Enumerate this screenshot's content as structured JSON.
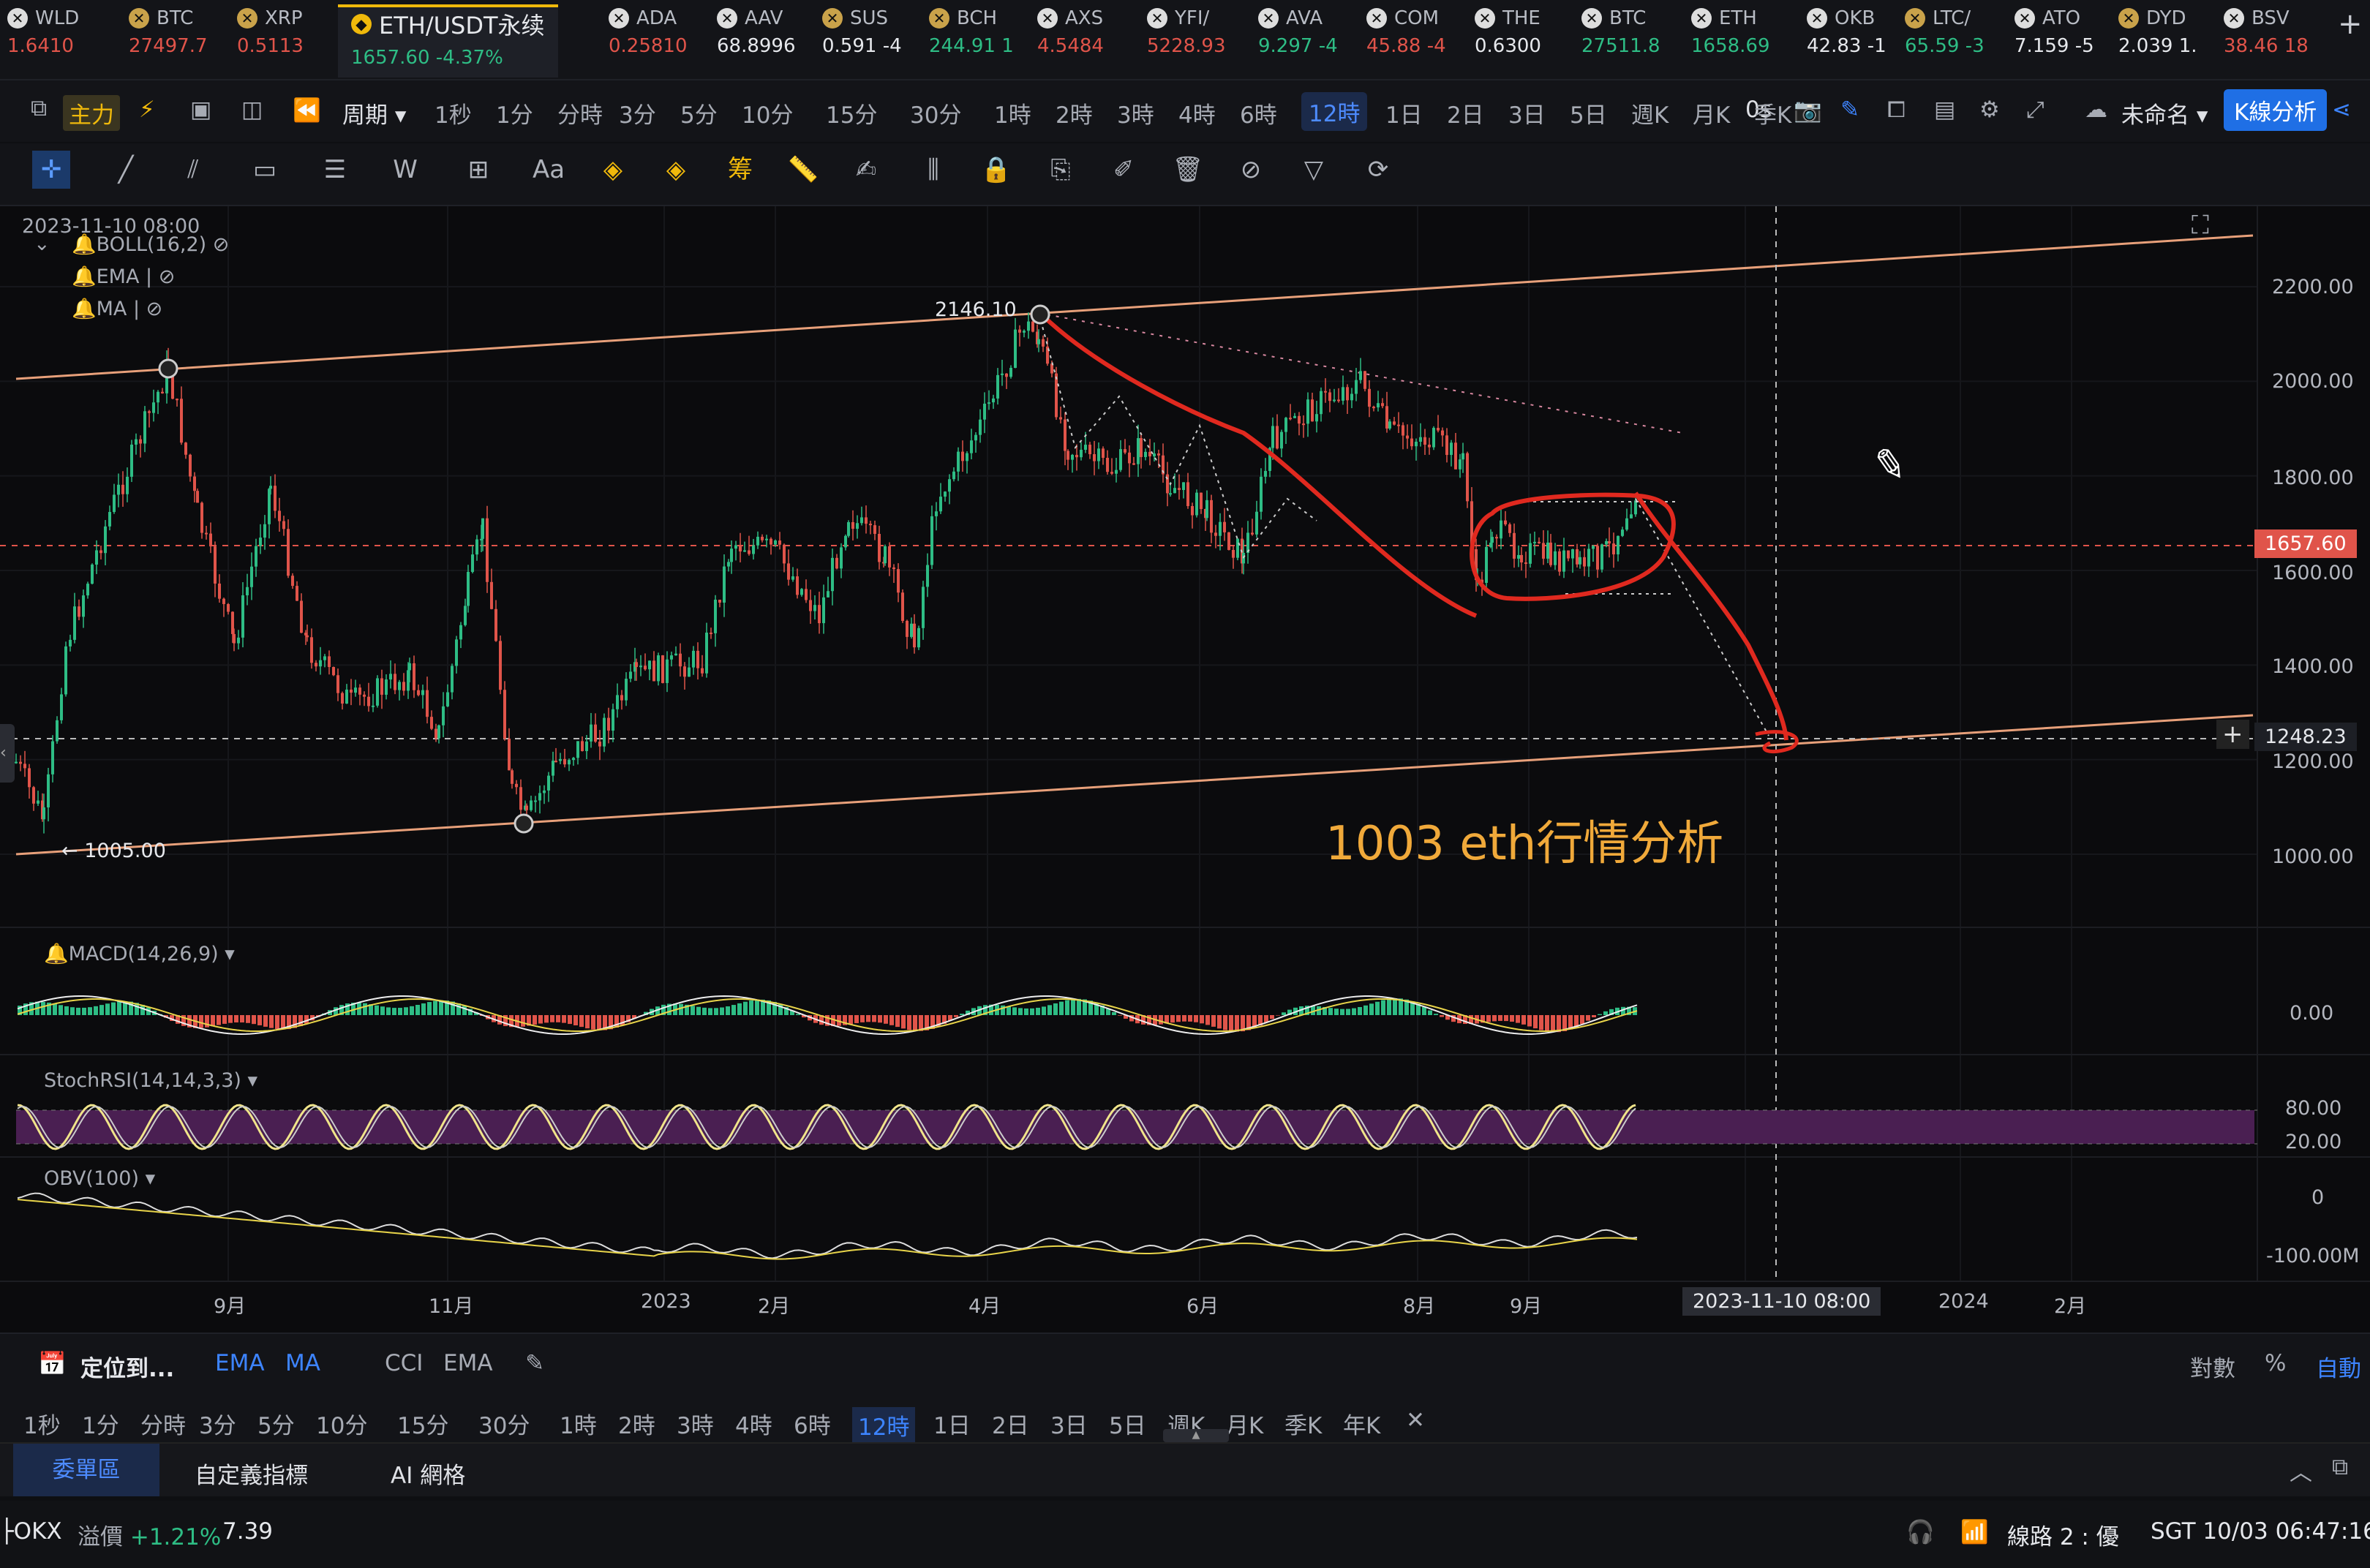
{
  "ticker": [
    {
      "name": "WLD",
      "price": "1.6410",
      "chg": "",
      "color": "red"
    },
    {
      "name": "BTC",
      "price": "27497.7",
      "chg": "",
      "color": "red"
    },
    {
      "name": "XRP",
      "price": "0.5113",
      "chg": "",
      "color": "red"
    },
    {
      "name": "ETH/USDT永续",
      "price": "1657.60",
      "chg": "-4.37%",
      "color": "green"
    },
    {
      "name": "ADA",
      "price": "0.25810",
      "chg": "",
      "color": "red"
    },
    {
      "name": "AAV",
      "price": "68.8996",
      "chg": "",
      "color": "white"
    },
    {
      "name": "SUS",
      "price": "0.591",
      "chg": "-4",
      "color": "white"
    },
    {
      "name": "BCH",
      "price": "244.91",
      "chg": "1",
      "color": "green"
    },
    {
      "name": "AXS",
      "price": "4.5484",
      "chg": "",
      "color": "red"
    },
    {
      "name": "YFI/",
      "price": "5228.93",
      "chg": "",
      "color": "red"
    },
    {
      "name": "AVA",
      "price": "9.297",
      "chg": "-4",
      "color": "green"
    },
    {
      "name": "COM",
      "price": "45.88",
      "chg": "-4",
      "color": "red"
    },
    {
      "name": "THE",
      "price": "0.6300",
      "chg": "",
      "color": "white"
    },
    {
      "name": "BTC",
      "price": "27511.8",
      "chg": "",
      "color": "green"
    },
    {
      "name": "ETH",
      "price": "1658.69",
      "chg": "",
      "color": "green"
    },
    {
      "name": "OKB",
      "price": "42.83",
      "chg": "-1",
      "color": "white"
    },
    {
      "name": "LTC/",
      "price": "65.59",
      "chg": "-3",
      "color": "green"
    },
    {
      "name": "ATO",
      "price": "7.159",
      "chg": "-5",
      "color": "white"
    },
    {
      "name": "DYD",
      "price": "2.039",
      "chg": "1.",
      "color": "white"
    },
    {
      "name": "BSV",
      "price": "38.46",
      "chg": "18",
      "color": "red"
    }
  ],
  "toolbar": {
    "main_label": "主力",
    "period_label": "周期",
    "intervals": [
      "1秒",
      "1分",
      "分時",
      "3分",
      "5分",
      "10分",
      "15分",
      "30分",
      "1時",
      "2時",
      "3時",
      "4時",
      "6時",
      "12時",
      "1日",
      "2日",
      "3日",
      "5日",
      "週K",
      "月K",
      "季K"
    ],
    "selected_interval": "12時",
    "replay": "0s",
    "layout_name": "未命名",
    "kline_button": "K線分析"
  },
  "chart": {
    "datetime": "2023-11-10 08:00",
    "indicators": [
      "BOLL(16,2)",
      "EMA",
      "MA"
    ],
    "price_axis": [
      "2200.00",
      "2000.00",
      "1800.00",
      "1600.00",
      "1400.00",
      "1200.00",
      "1000.00"
    ],
    "current_price": "1657.60",
    "crosshair_price": "1248.23",
    "crosshair_time": "2023-11-10 08:00",
    "high_label": "2146.10",
    "low_label": "1005.00",
    "time_axis": [
      "9月",
      "11月",
      "2023",
      "2月",
      "4月",
      "6月",
      "8月",
      "9月",
      "2024",
      "2月"
    ],
    "annotation": "1003 eth行情分析",
    "macd": {
      "label": "MACD(14,26,9)",
      "axis": "0.00"
    },
    "stochrsi": {
      "label": "StochRSI(14,14,3,3)",
      "axis_hi": "80.00",
      "axis_lo": "20.00"
    },
    "obv": {
      "label": "OBV(100)",
      "axis_top": "0",
      "axis_bot": "-100.00M"
    }
  },
  "bottom": {
    "locate": "定位到...",
    "indicators": [
      "EMA",
      "MA",
      "CCI",
      "EMA"
    ],
    "right": [
      "對數",
      "%",
      "自動"
    ],
    "intervals": [
      "1秒",
      "1分",
      "分時",
      "3分",
      "5分",
      "10分",
      "15分",
      "30分",
      "1時",
      "2時",
      "3時",
      "4時",
      "6時",
      "12時",
      "1日",
      "2日",
      "3日",
      "5日",
      "週K",
      "月K",
      "季K",
      "年K"
    ],
    "selected_interval": "12時",
    "tabs": [
      "委單區",
      "自定義指標",
      "AI 網格"
    ],
    "active_tab": "委單區"
  },
  "status": {
    "exchange": "OKX",
    "premium_label": "溢價",
    "premium": "+1.21%",
    "premium_value": "7.39",
    "line": "線路 2 : 優",
    "clock": "SGT  10/03 06:47:16"
  }
}
